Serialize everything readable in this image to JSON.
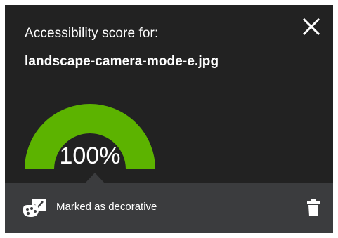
{
  "header": {
    "title": "Accessibility score for:",
    "filename": "landscape-camera-mode-e.jpg",
    "close_icon": "close-icon"
  },
  "score": {
    "label": "100%",
    "value_percent": 100,
    "gauge_color": "#5cb300",
    "track_color": "#3b3c3e"
  },
  "status": {
    "label": "Marked as decorative",
    "icon": "decorative-image-icon",
    "delete_icon": "trash-icon"
  },
  "colors": {
    "panel_bg": "#222222",
    "status_bg": "#3b3c3e",
    "text": "#ffffff"
  }
}
